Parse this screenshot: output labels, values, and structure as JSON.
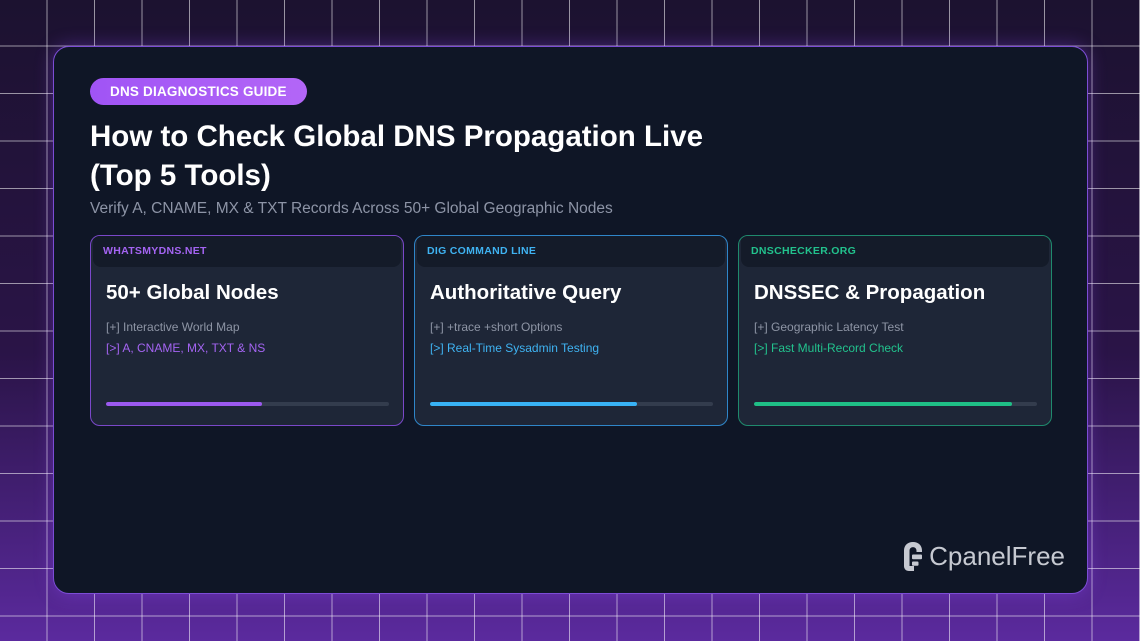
{
  "badge": "DNS DIAGNOSTICS GUIDE",
  "title": "How to Check Global DNS Propagation Live (Top 5 Tools)",
  "subtitle": "Verify A, CNAME, MX & TXT Records Across 50+ Global Geographic Nodes",
  "cards": [
    {
      "tag": "WHATSMYDNS.NET",
      "title": "50+ Global Nodes",
      "line1": "[+] Interactive World Map",
      "line2": "[>] A, CNAME, MX, TXT & NS",
      "progress": 0.55,
      "accent": "#9b59ef"
    },
    {
      "tag": "DIG COMMAND LINE",
      "title": "Authoritative Query",
      "line1": "[+] +trace +short Options",
      "line2": "[>] Real-Time Sysadmin Testing",
      "progress": 0.73,
      "accent": "#38b2f5"
    },
    {
      "tag": "DNSCHECKER.ORG",
      "title": "DNSSEC & Propagation",
      "line1": "[+] Geographic Latency Test",
      "line2": "[>] Fast Multi-Record Check",
      "progress": 0.91,
      "accent": "#1fbf86"
    }
  ],
  "brand": {
    "name": "CpanelFree",
    "icon": "cpanel-free-logo-icon"
  },
  "colors": {
    "badge": "#a054f5",
    "panel": "#0f1626",
    "card": "#1e2637"
  }
}
